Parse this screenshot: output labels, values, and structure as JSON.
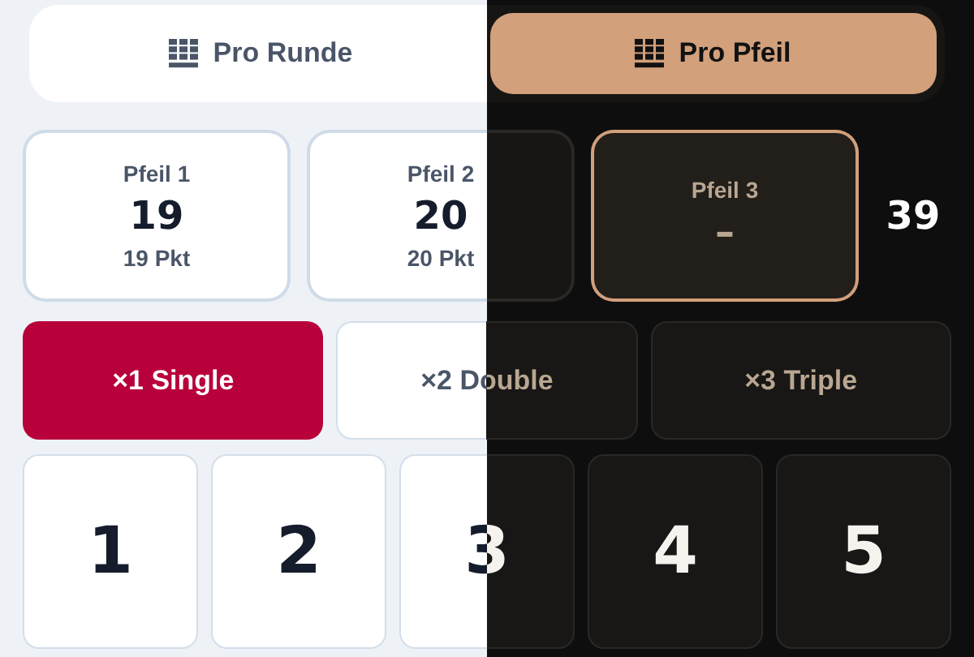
{
  "tabs": [
    {
      "label": "Pro Runde",
      "selected": false
    },
    {
      "label": "Pro Pfeil",
      "selected": true
    }
  ],
  "darts": [
    {
      "label": "Pfeil 1",
      "value": "19",
      "points": "19 Pkt",
      "selected": false
    },
    {
      "label": "Pfeil 2",
      "value": "20",
      "points": "20 Pkt",
      "selected": false
    },
    {
      "label": "Pfeil 3",
      "value": "–",
      "selected": true
    }
  ],
  "total": "39",
  "multipliers": [
    {
      "label": "×1 Single",
      "selected": true
    },
    {
      "label": "×2 Double",
      "selected": false
    },
    {
      "label": "×3 Triple",
      "selected": false
    }
  ],
  "keys": [
    "1",
    "2",
    "3",
    "4",
    "5"
  ]
}
